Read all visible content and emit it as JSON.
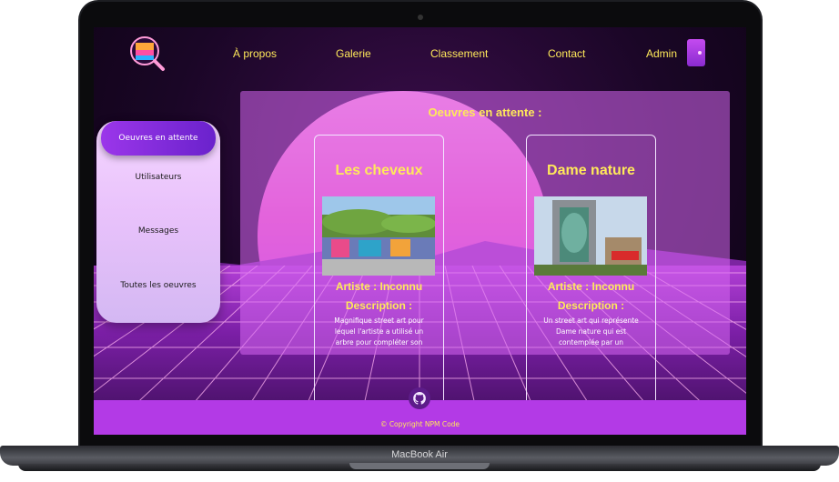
{
  "device": {
    "brand_label": "MacBook Air"
  },
  "nav": {
    "links": [
      {
        "label": "À propos"
      },
      {
        "label": "Galerie"
      },
      {
        "label": "Classement"
      },
      {
        "label": "Contact"
      },
      {
        "label": "Admin"
      }
    ]
  },
  "sidebar": {
    "items": [
      {
        "label": "Oeuvres en attente",
        "active": true
      },
      {
        "label": "Utilisateurs"
      },
      {
        "label": "Messages"
      },
      {
        "label": "Toutes les oeuvres"
      }
    ]
  },
  "main": {
    "title": "Oeuvres en attente :",
    "cards": [
      {
        "title": "Les cheveux",
        "artist": "Artiste : Inconnu",
        "description_label": "Description :",
        "description": "Magnifique street art pour lequel l'artiste a utilisé un arbre pour compléter son"
      },
      {
        "title": "Dame nature",
        "artist": "Artiste : Inconnu",
        "description_label": "Description :",
        "description": "Un street art qui représente Dame nature qui est contemplée par un"
      }
    ]
  },
  "footer": {
    "copyright": "© Copyright NPM Code"
  },
  "colors": {
    "accent_yellow": "#ffe95a",
    "purple": "#b33ae6",
    "active_button": "#7b2bd6"
  }
}
